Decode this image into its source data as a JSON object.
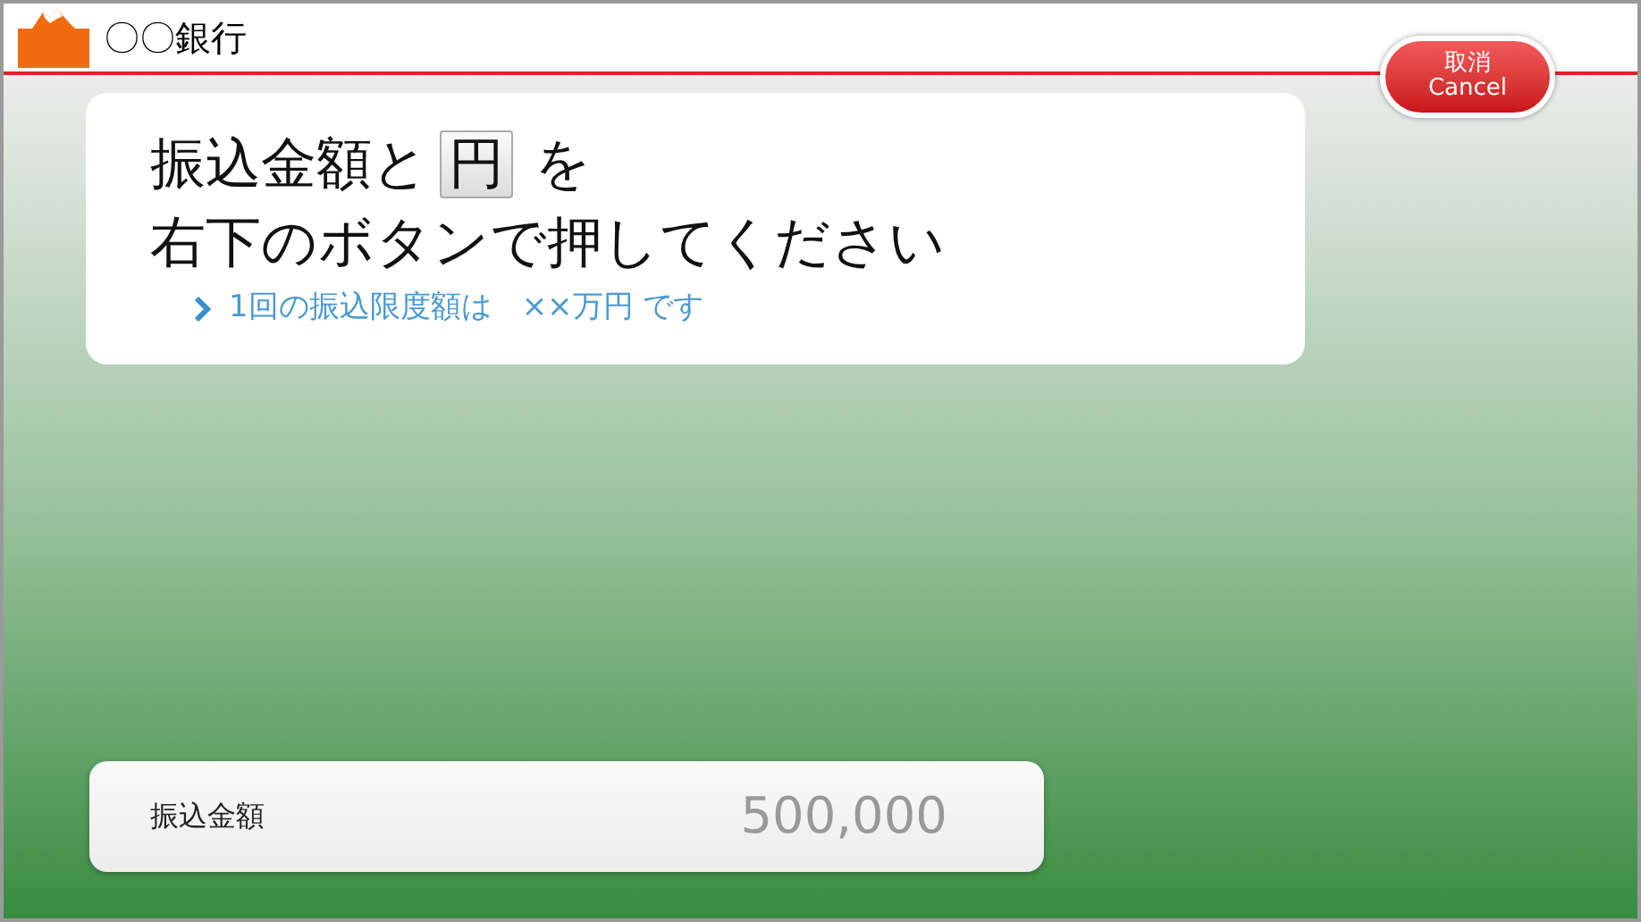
{
  "header": {
    "bank_name": "〇〇銀行"
  },
  "cancel_button": {
    "label": "取消",
    "sublabel": "Cancel"
  },
  "instruction": {
    "before_key": "振込金額と",
    "key": "円",
    "after_key": "を",
    "line_2": "右下のボタンで押してください",
    "note": "1回の振込限度額は　××万円 です"
  },
  "amount_field": {
    "label": "振込金額",
    "value": "500,000"
  }
}
